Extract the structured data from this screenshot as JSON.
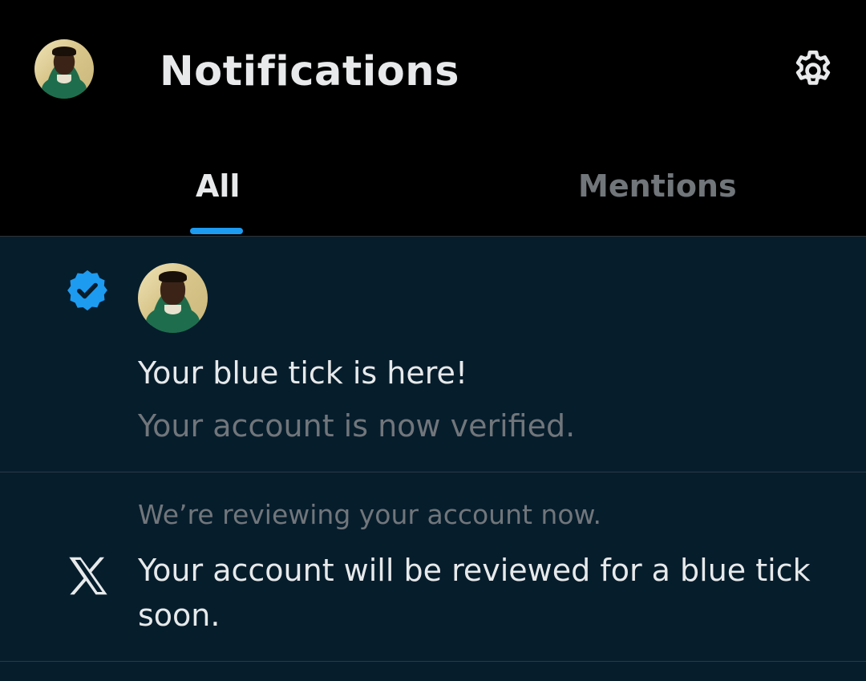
{
  "header": {
    "title": "Notifications",
    "avatar_icon": "user-avatar",
    "settings_icon": "gear-icon"
  },
  "tabs": [
    {
      "label": "All",
      "active": true
    },
    {
      "label": "Mentions",
      "active": false
    }
  ],
  "notifications": [
    {
      "icon": "verified-badge-icon",
      "title": "Your blue tick is here!",
      "subtitle": "Your account is now verified."
    },
    {
      "icon": "x-logo-icon",
      "header": "We’re reviewing your account now.",
      "body": "Your account will be reviewed for a blue tick soon."
    }
  ],
  "colors": {
    "background": "#000000",
    "list_background": "#061d2c",
    "accent": "#1d9bf0",
    "primary_text": "#e7e9ea",
    "secondary_text": "#71767b"
  }
}
